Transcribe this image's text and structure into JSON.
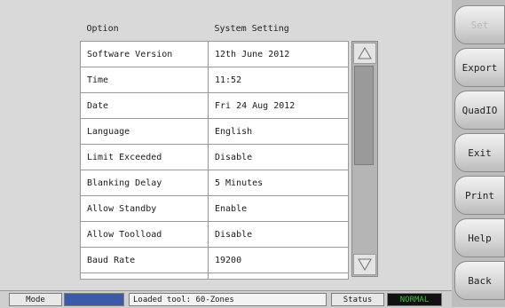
{
  "table": {
    "headers": [
      "Option",
      "System Setting"
    ],
    "rows": [
      {
        "option": "Software Version",
        "value": "12th June 2012"
      },
      {
        "option": "Time",
        "value": "11:52"
      },
      {
        "option": "Date",
        "value": "Fri 24 Aug 2012"
      },
      {
        "option": "Language",
        "value": "English"
      },
      {
        "option": "Limit Exceeded",
        "value": "Disable"
      },
      {
        "option": "Blanking Delay",
        "value": "5 Minutes"
      },
      {
        "option": "Allow Standby",
        "value": "Enable"
      },
      {
        "option": "Allow Toolload",
        "value": "Disable"
      },
      {
        "option": "Baud Rate",
        "value": "19200"
      }
    ]
  },
  "side_buttons": [
    {
      "label": "Set",
      "enabled": false
    },
    {
      "label": "Export",
      "enabled": true
    },
    {
      "label": "QuadIO",
      "enabled": true
    },
    {
      "label": "Exit",
      "enabled": true
    },
    {
      "label": "Print",
      "enabled": true
    },
    {
      "label": "Help",
      "enabled": true
    },
    {
      "label": "Back",
      "enabled": true
    }
  ],
  "status_bar": {
    "mode_label": "Mode",
    "mode_value": "",
    "tool_text": "Loaded tool: 60-Zones",
    "status_label": "Status",
    "status_value": "NORMAL"
  },
  "colors": {
    "mode_value_bg": "#3c5aa8",
    "status_value_fg": "#3fbf3f",
    "status_value_bg": "#111111"
  },
  "icons": {
    "scroll_up": "triangle-up-icon",
    "scroll_down": "triangle-down-icon"
  }
}
